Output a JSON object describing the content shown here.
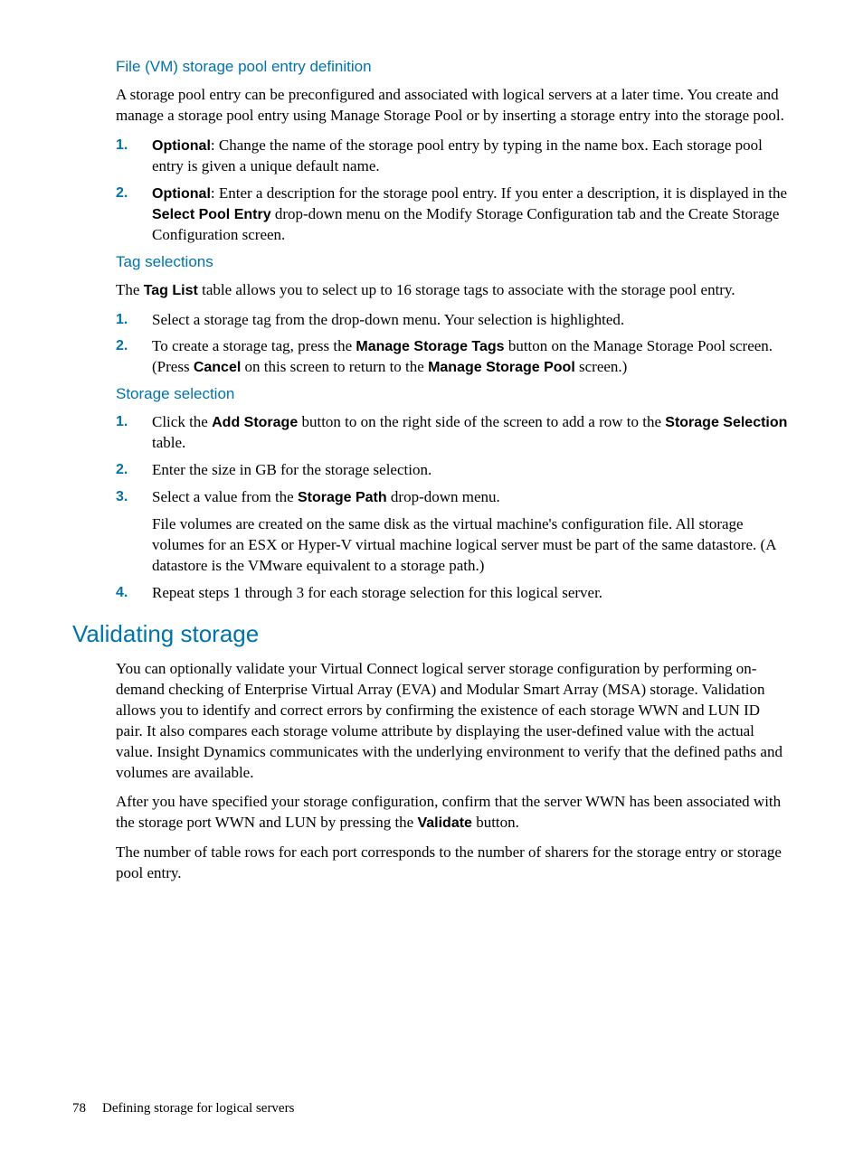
{
  "sec1": {
    "heading": "File (VM) storage pool entry definition",
    "intro": "A storage pool entry can be preconfigured and associated with logical servers at a later time. You create and manage a storage pool entry using Manage Storage Pool or by inserting a storage entry into the storage pool.",
    "li1_bold": "Optional",
    "li1_rest": ": Change the name of the storage pool entry by typing in the name box. Each storage pool entry is given a unique default name.",
    "li2_bold": "Optional",
    "li2_pre": ": Enter a description for the storage pool entry. If you enter a description, it is displayed in the ",
    "li2_bold2": "Select Pool Entry",
    "li2_post": " drop-down menu on the Modify Storage Configuration tab and the Create Storage Configuration screen."
  },
  "sec2": {
    "heading": "Tag selections",
    "intro_pre": "The ",
    "intro_bold": "Tag List",
    "intro_post": " table allows you to select up to 16 storage tags to associate with the storage pool entry.",
    "li1": "Select a storage tag from the drop-down menu. Your selection is highlighted.",
    "li2_pre": "To create a storage tag, press the ",
    "li2_b1": "Manage Storage Tags",
    "li2_mid": " button on the Manage Storage Pool screen. (Press ",
    "li2_b2": "Cancel",
    "li2_mid2": " on this screen to return to the ",
    "li2_b3": "Manage Storage Pool",
    "li2_post": " screen.)"
  },
  "sec3": {
    "heading": "Storage selection",
    "li1_pre": "Click the ",
    "li1_b1": "Add Storage",
    "li1_mid": " button to on the right side of the screen to add a row to the ",
    "li1_b2": "Storage Selection",
    "li1_post": " table.",
    "li2": "Enter the size in GB for the storage selection.",
    "li3_pre": "Select a value from the ",
    "li3_b1": "Storage Path",
    "li3_post": " drop-down menu.",
    "li3_sub": "File volumes are created on the same disk as the virtual machine's configuration file. All storage volumes for an ESX or Hyper-V virtual machine logical server must be part of the same datastore. (A datastore is the VMware equivalent to a storage path.)",
    "li4": "Repeat steps 1 through 3 for each storage selection for this logical server."
  },
  "sec4": {
    "heading": "Validating storage",
    "p1": "You can optionally validate your Virtual Connect logical server storage configuration by performing on-demand checking of Enterprise Virtual Array (EVA) and Modular Smart Array (MSA) storage. Validation allows you to identify and correct errors by confirming the existence of each storage WWN and LUN ID pair. It also compares each storage volume attribute by displaying the user-defined value with the actual value. Insight Dynamics communicates with the underlying environment to verify that the defined paths and volumes are available.",
    "p2_pre": "After you have specified your storage configuration, confirm that the server WWN has been associated with the storage port WWN and LUN by pressing the ",
    "p2_b": "Validate",
    "p2_post": " button.",
    "p3": "The number of table rows for each port corresponds to the number of sharers for the storage entry or storage pool entry."
  },
  "footer": {
    "page": "78",
    "title": "Defining storage for logical servers"
  }
}
